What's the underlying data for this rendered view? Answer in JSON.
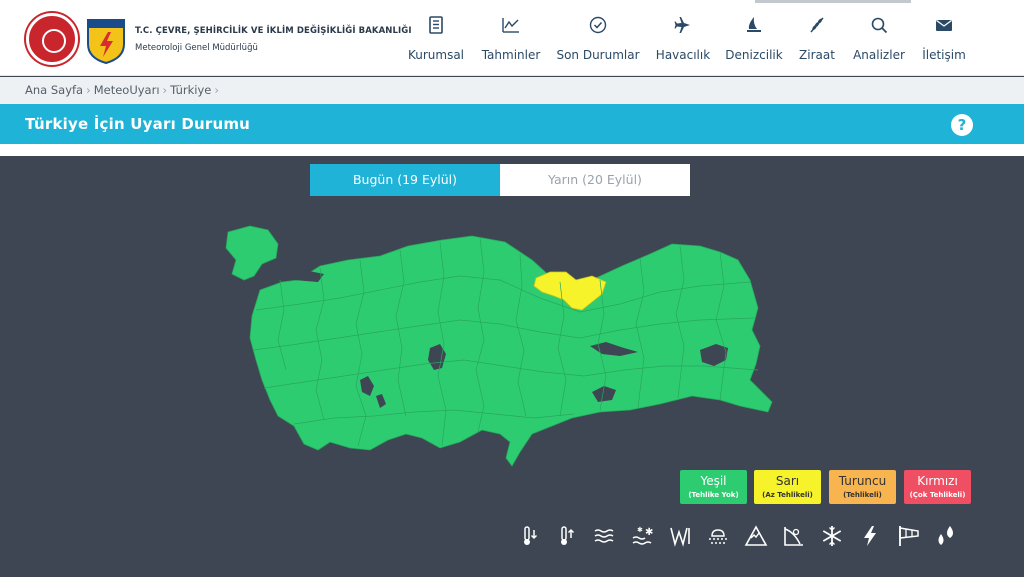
{
  "header": {
    "org_name": "T.C. ÇEVRE, ŞEHİRCİLİK VE İKLİM DEĞİŞİKLİĞİ BAKANLIĞI",
    "org_sub": "Meteoroloji Genel Müdürlüğü",
    "logo_text": "METEOROLOJİ"
  },
  "nav": [
    {
      "label": "Kurumsal",
      "icon": "document-icon"
    },
    {
      "label": "Tahminler",
      "icon": "chart-icon"
    },
    {
      "label": "Son Durumlar",
      "icon": "check-circle-icon"
    },
    {
      "label": "Havacılık",
      "icon": "plane-icon"
    },
    {
      "label": "Denizcilik",
      "icon": "sailboat-icon"
    },
    {
      "label": "Ziraat",
      "icon": "wheat-icon"
    },
    {
      "label": "Analizler",
      "icon": "magnifier-icon"
    },
    {
      "label": "İletişim",
      "icon": "envelope-icon"
    }
  ],
  "breadcrumb": [
    "Ana Sayfa",
    "MeteoUyarı",
    "Türkiye"
  ],
  "page_title": "Türkiye İçin Uyarı Durumu",
  "help": "?",
  "tabs": {
    "today": "Bugün (19 Eylül)",
    "tomorrow": "Yarın (20 Eylül)"
  },
  "map": {
    "base_color": "#2ecc71",
    "warning_color": "#f6f32b",
    "lake_color": "#3d4652"
  },
  "legend": [
    {
      "name": "Yeşil",
      "sub": "(Tehlike Yok)",
      "color": "#2ecc71"
    },
    {
      "name": "Sarı",
      "sub": "(Az Tehlikeli)",
      "color": "#f6f32b"
    },
    {
      "name": "Turuncu",
      "sub": "(Tehlikeli)",
      "color": "#f8b44f"
    },
    {
      "name": "Kırmızı",
      "sub": "(Çok Tehlikeli)",
      "color": "#ef4e63"
    }
  ],
  "weather_icons": [
    "cold-temperature-icon",
    "hot-temperature-icon",
    "fog-icon",
    "snow-storm-icon",
    "wind-icon",
    "rain-icon",
    "avalanche-icon",
    "landslide-icon",
    "snowflake-icon",
    "lightning-icon",
    "windsock-icon",
    "hail-icon"
  ]
}
